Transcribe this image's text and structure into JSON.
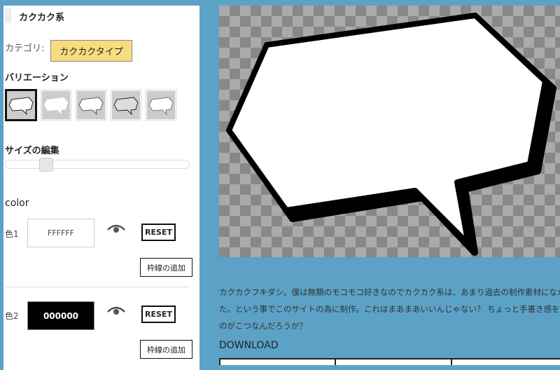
{
  "panel": {
    "title": "カクカク系",
    "category_label": "カテゴリ:",
    "category_value": "カクカクタイプ",
    "variation_heading": "バリエーション",
    "variations": [
      "variation-1",
      "variation-2",
      "variation-3",
      "variation-4",
      "variation-5"
    ],
    "size_heading": "サイズの編集",
    "size_value_percent": 20,
    "color_heading": "color",
    "colors": [
      {
        "label": "色1",
        "value": "FFFFFF",
        "reset": "RESET",
        "add_border": "枠線の追加"
      },
      {
        "label": "色2",
        "value": "000000",
        "reset": "RESET",
        "add_border": "枠線の追加"
      }
    ]
  },
  "main": {
    "description_lines": [
      "カクカクフキダシ。僕は無類のモコモコ好きなのでカクカク系は、あまり過去の制作素材になかっ",
      "た。という事でこのサイトの為に制作。これはまあまあいいんじゃない？ ちょっと手書き感を出す",
      "のがこつなんだろうか？"
    ],
    "download_heading": "DOWNLOAD"
  },
  "colors": {
    "background": "#5ba2c6",
    "category_badge": "#f7dc80"
  }
}
